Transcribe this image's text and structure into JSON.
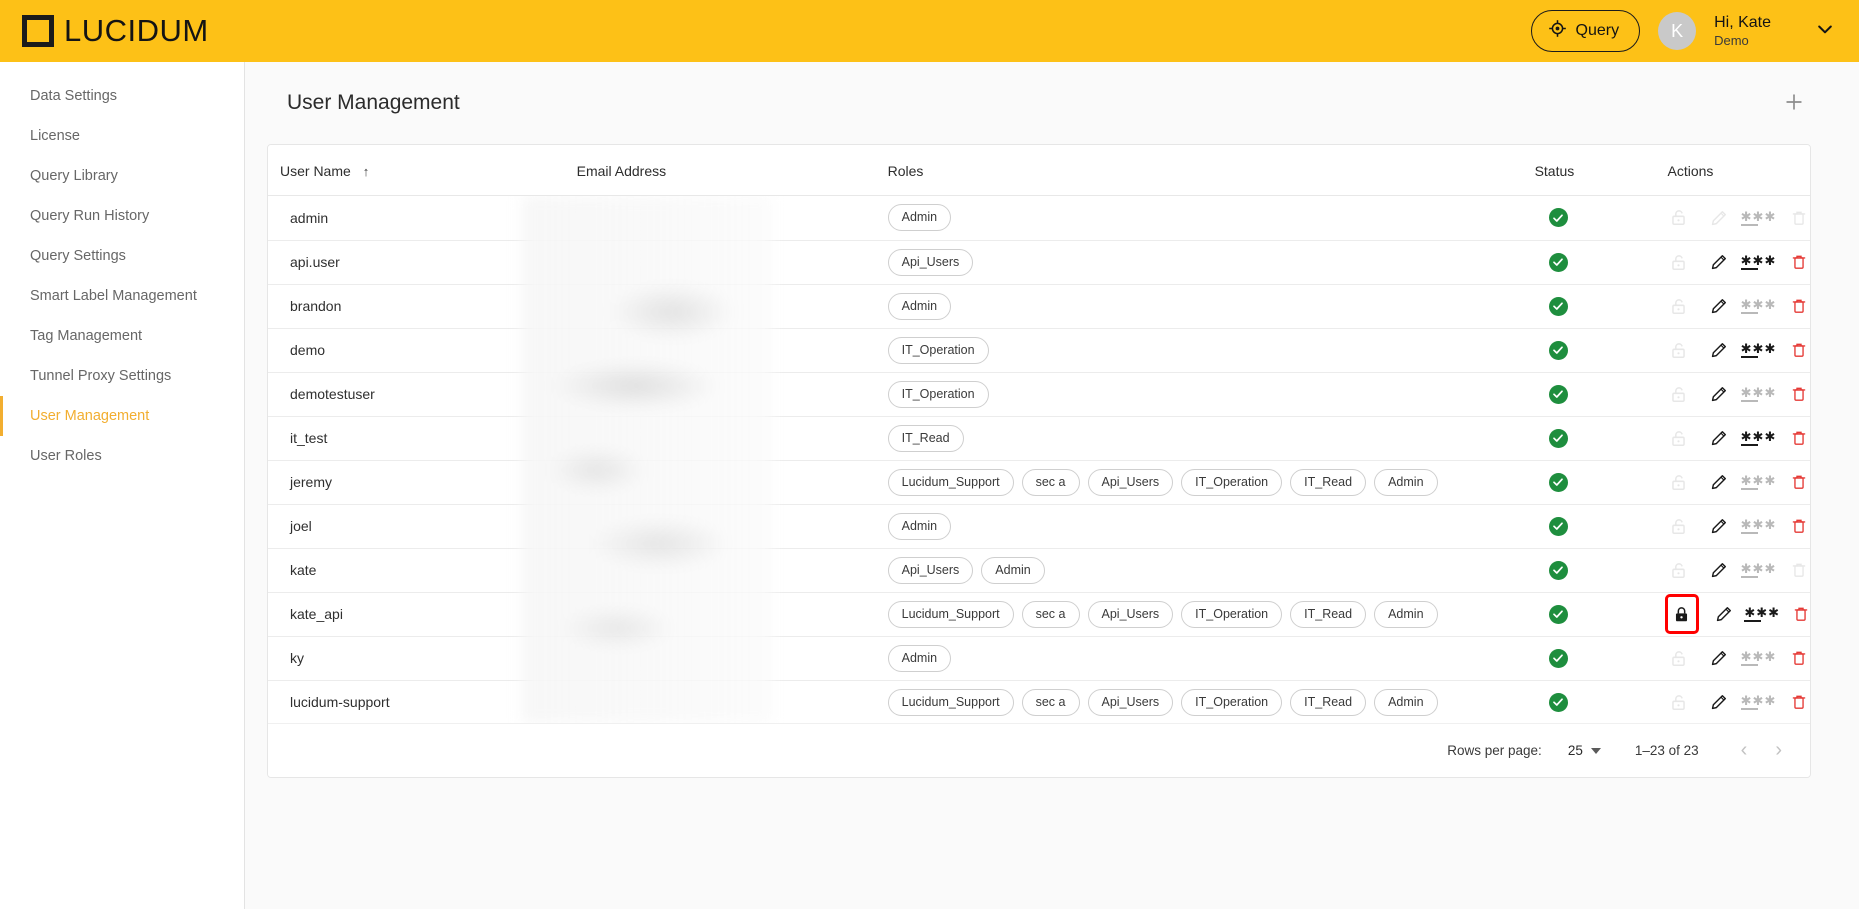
{
  "topbar": {
    "logo_text": "LUCIDUM",
    "logo_icon": "square-outline-logo",
    "query_button": {
      "label": "Query",
      "icon": "target-crosshair-icon"
    },
    "avatar_initial": "K",
    "greeting": "Hi, Kate",
    "tenant": "Demo",
    "chevron_icon": "chevron-down-icon",
    "bg_color": "#FDC117"
  },
  "sidebar": {
    "items": [
      {
        "label": "Data Settings",
        "active": false
      },
      {
        "label": "License",
        "active": false
      },
      {
        "label": "Query Library",
        "active": false
      },
      {
        "label": "Query Run History",
        "active": false
      },
      {
        "label": "Query Settings",
        "active": false
      },
      {
        "label": "Smart Label Management",
        "active": false
      },
      {
        "label": "Tag Management",
        "active": false
      },
      {
        "label": "Tunnel Proxy Settings",
        "active": false
      },
      {
        "label": "User Management",
        "active": true
      },
      {
        "label": "User Roles",
        "active": false
      }
    ],
    "active_color": "#F2AE30"
  },
  "page": {
    "title": "User Management",
    "add_button_icon": "plus-icon"
  },
  "table": {
    "columns": [
      {
        "key": "user_name",
        "label": "User Name",
        "sorted": "asc",
        "sort_icon": "arrow-up-icon"
      },
      {
        "key": "email",
        "label": "Email Address"
      },
      {
        "key": "roles",
        "label": "Roles"
      },
      {
        "key": "status",
        "label": "Status"
      },
      {
        "key": "actions",
        "label": "Actions"
      }
    ],
    "email_column_redacted": true,
    "action_icons": [
      "lock-icon",
      "pencil-edit-icon",
      "password-icon",
      "trash-delete-icon"
    ],
    "status_icon": "check-circle-icon",
    "status_color": "#1E8E3E",
    "highlight_color": "#ff0000",
    "rows": [
      {
        "user_name": "admin",
        "email": "",
        "roles": [
          "Admin"
        ],
        "status": "active",
        "lock": "unlocked",
        "lock_enabled": false,
        "edit_enabled": false,
        "password_enabled": false,
        "delete_enabled": false,
        "highlighted": false
      },
      {
        "user_name": "api.user",
        "email": "",
        "roles": [
          "Api_Users"
        ],
        "status": "active",
        "lock": "unlocked",
        "lock_enabled": false,
        "edit_enabled": true,
        "password_enabled": true,
        "delete_enabled": true,
        "highlighted": false
      },
      {
        "user_name": "brandon",
        "email": "",
        "roles": [
          "Admin"
        ],
        "status": "active",
        "lock": "unlocked",
        "lock_enabled": false,
        "edit_enabled": true,
        "password_enabled": false,
        "delete_enabled": true,
        "highlighted": false
      },
      {
        "user_name": "demo",
        "email": "",
        "roles": [
          "IT_Operation"
        ],
        "status": "active",
        "lock": "unlocked",
        "lock_enabled": false,
        "edit_enabled": true,
        "password_enabled": true,
        "delete_enabled": true,
        "highlighted": false
      },
      {
        "user_name": "demotestuser",
        "email": "",
        "roles": [
          "IT_Operation"
        ],
        "status": "active",
        "lock": "unlocked",
        "lock_enabled": false,
        "edit_enabled": true,
        "password_enabled": false,
        "delete_enabled": true,
        "highlighted": false
      },
      {
        "user_name": "it_test",
        "email": "",
        "roles": [
          "IT_Read"
        ],
        "status": "active",
        "lock": "unlocked",
        "lock_enabled": false,
        "edit_enabled": true,
        "password_enabled": true,
        "delete_enabled": true,
        "highlighted": false
      },
      {
        "user_name": "jeremy",
        "email": "",
        "roles": [
          "Lucidum_Support",
          "sec a",
          "Api_Users",
          "IT_Operation",
          "IT_Read",
          "Admin"
        ],
        "status": "active",
        "lock": "unlocked",
        "lock_enabled": false,
        "edit_enabled": true,
        "password_enabled": false,
        "delete_enabled": true,
        "highlighted": false
      },
      {
        "user_name": "joel",
        "email": "",
        "roles": [
          "Admin"
        ],
        "status": "active",
        "lock": "unlocked",
        "lock_enabled": false,
        "edit_enabled": true,
        "password_enabled": false,
        "delete_enabled": true,
        "highlighted": false
      },
      {
        "user_name": "kate",
        "email": "",
        "roles": [
          "Api_Users",
          "Admin"
        ],
        "status": "active",
        "lock": "unlocked",
        "lock_enabled": false,
        "edit_enabled": true,
        "password_enabled": false,
        "delete_enabled": false,
        "highlighted": false
      },
      {
        "user_name": "kate_api",
        "email": "",
        "roles": [
          "Lucidum_Support",
          "sec a",
          "Api_Users",
          "IT_Operation",
          "IT_Read",
          "Admin"
        ],
        "status": "active",
        "lock": "locked",
        "lock_enabled": true,
        "edit_enabled": true,
        "password_enabled": true,
        "delete_enabled": true,
        "highlighted": true
      },
      {
        "user_name": "ky",
        "email": "",
        "roles": [
          "Admin"
        ],
        "status": "active",
        "lock": "unlocked",
        "lock_enabled": false,
        "edit_enabled": true,
        "password_enabled": false,
        "delete_enabled": true,
        "highlighted": false
      },
      {
        "user_name": "lucidum-support",
        "email": "",
        "roles": [
          "Lucidum_Support",
          "sec a",
          "Api_Users",
          "IT_Operation",
          "IT_Read",
          "Admin"
        ],
        "status": "active",
        "lock": "unlocked",
        "lock_enabled": false,
        "edit_enabled": true,
        "password_enabled": false,
        "delete_enabled": true,
        "highlighted": false
      }
    ]
  },
  "footer": {
    "rows_per_page_label": "Rows per page:",
    "rows_per_page_value": "25",
    "range_text": "1–23 of 23",
    "prev_icon": "chevron-left-icon",
    "next_icon": "chevron-right-icon",
    "prev_label": "‹",
    "next_label": "›"
  }
}
